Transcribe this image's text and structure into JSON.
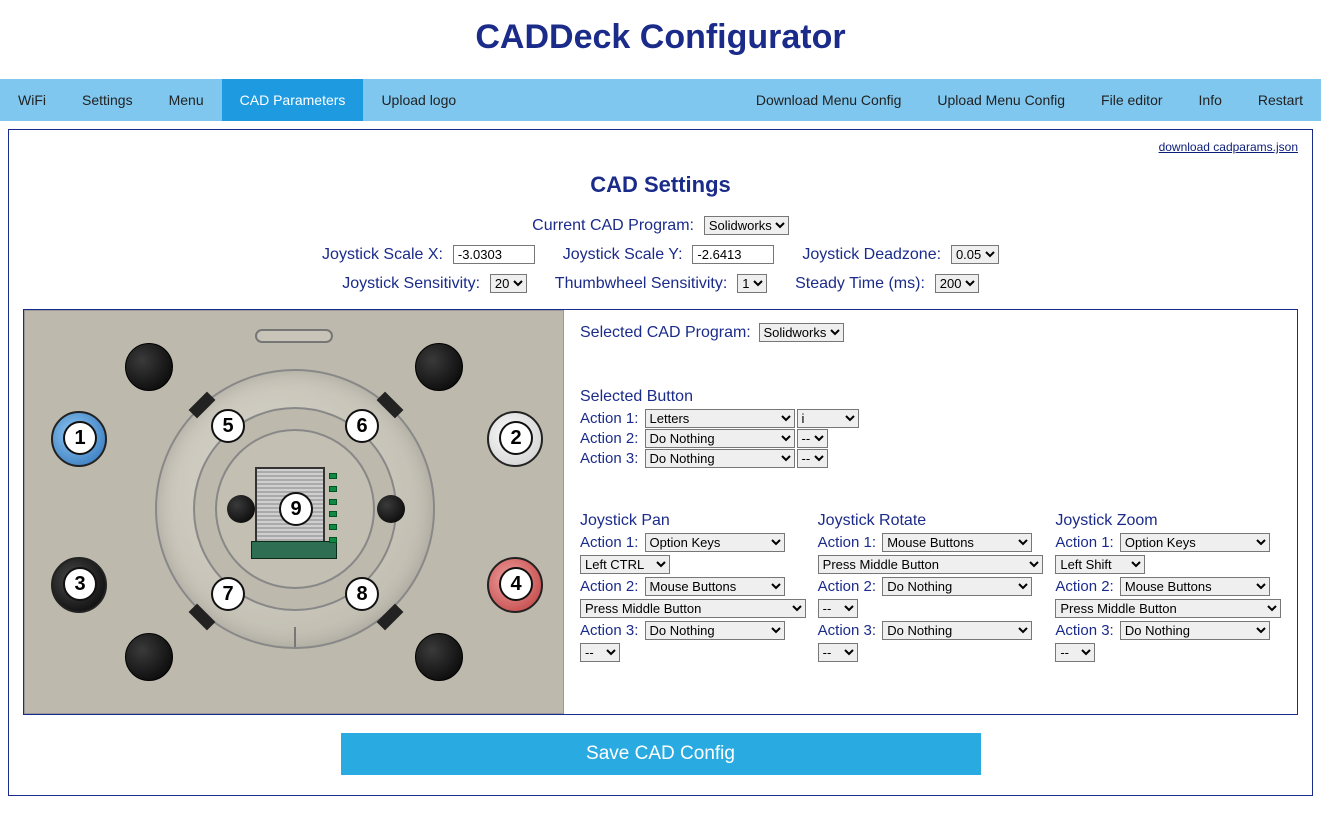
{
  "title": "CADDeck Configurator",
  "nav": {
    "left": [
      "WiFi",
      "Settings",
      "Menu",
      "CAD Parameters",
      "Upload logo"
    ],
    "right": [
      "Download Menu Config",
      "Upload Menu Config",
      "File editor",
      "Info",
      "Restart"
    ],
    "active": "CAD Parameters"
  },
  "download_link": "download cadparams.json",
  "heading": "CAD Settings",
  "labels": {
    "current_program": "Current CAD Program:",
    "joy_scale_x": "Joystick Scale X:",
    "joy_scale_y": "Joystick Scale Y:",
    "joy_deadzone": "Joystick Deadzone:",
    "joy_sens": "Joystick Sensitivity:",
    "thumb_sens": "Thumbwheel Sensitivity:",
    "steady": "Steady Time (ms):",
    "selected_program": "Selected CAD Program:",
    "selected_button": "Selected Button",
    "action1": "Action 1:",
    "action2": "Action 2:",
    "action3": "Action 3:",
    "joy_pan": "Joystick Pan",
    "joy_rotate": "Joystick Rotate",
    "joy_zoom": "Joystick Zoom"
  },
  "values": {
    "current_program": "Solidworks",
    "joy_scale_x": "-3.0303",
    "joy_scale_y": "-2.6413",
    "joy_deadzone": "0.05",
    "joy_sens": "20",
    "thumb_sens": "1",
    "steady": "200",
    "selected_program": "Solidworks",
    "selected_button": {
      "a1_type": "Letters",
      "a1_val": "i",
      "a2_type": "Do Nothing",
      "a2_val": "--",
      "a3_type": "Do Nothing",
      "a3_val": "--"
    },
    "pan": {
      "a1_type": "Option Keys",
      "a1_val": "Left CTRL",
      "a2_type": "Mouse Buttons",
      "a2_val": "Press Middle Button",
      "a3_type": "Do Nothing",
      "a3_val": "--"
    },
    "rotate": {
      "a1_type": "Mouse Buttons",
      "a1_val": "Press Middle Button",
      "a2_type": "Do Nothing",
      "a2_val": "--",
      "a3_type": "Do Nothing",
      "a3_val": "--"
    },
    "zoom": {
      "a1_type": "Option Keys",
      "a1_val": "Left Shift",
      "a2_type": "Mouse Buttons",
      "a2_val": "Press Middle Button",
      "a3_type": "Do Nothing",
      "a3_val": "--"
    }
  },
  "diagram_numbers": [
    "1",
    "2",
    "3",
    "4",
    "5",
    "6",
    "7",
    "8",
    "9"
  ],
  "save_label": "Save CAD Config"
}
